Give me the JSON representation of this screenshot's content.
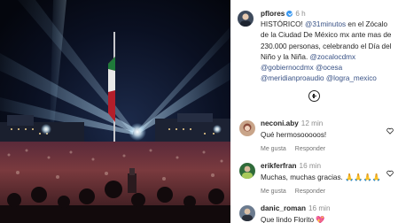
{
  "post": {
    "username": "pflores",
    "time": "6 h",
    "caption_parts": [
      {
        "text": "HISTÓRICO! ",
        "link": false
      },
      {
        "text": "@31minutos",
        "link": true
      },
      {
        "text": " en el Zócalo de la Ciudad De México mx ante mas de 230.000 personas, celebrando el Día del Niño y la Niña. ",
        "link": false
      },
      {
        "text": "@zocalocdmx",
        "link": true
      },
      {
        "text": " ",
        "link": false
      },
      {
        "text": "@gobiernocdmx",
        "link": true
      },
      {
        "text": " ",
        "link": false
      },
      {
        "text": "@ocesa",
        "link": true
      },
      {
        "text": " ",
        "link": false
      },
      {
        "text": "@meridianproaudio",
        "link": true
      },
      {
        "text": " ",
        "link": false
      },
      {
        "text": "@logra_mexico",
        "link": true
      }
    ]
  },
  "comments": [
    {
      "username": "neconi.aby",
      "time": "12 min",
      "text": "Qué hermosooooos!",
      "like_label": "Me gusta",
      "reply_label": "Responder"
    },
    {
      "username": "erikferfran",
      "time": "16 min",
      "text": "Muchas, muchas gracias. 🙏🙏🙏🙏",
      "like_label": "Me gusta",
      "reply_label": "Responder"
    },
    {
      "username": "danic_roman",
      "time": "16 min",
      "text": "Que lindo Florito 💖"
    }
  ],
  "colors": {
    "link": "#385185",
    "verified": "#3897f0",
    "meta": "#8e8e8e"
  },
  "icons": {
    "add": "add-circle-icon",
    "like": "heart-icon",
    "verified": "verified-badge-icon"
  }
}
